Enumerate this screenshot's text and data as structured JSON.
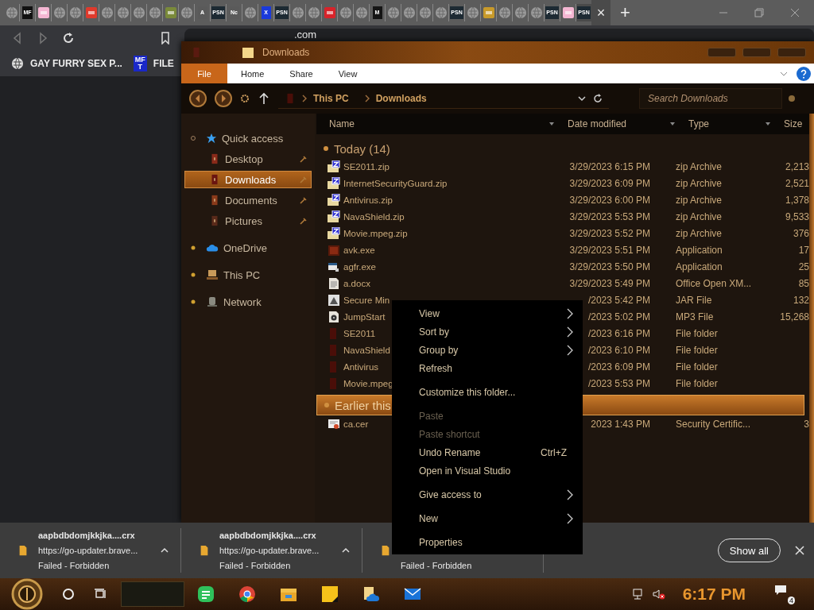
{
  "browser": {
    "tabs": [
      {
        "kind": "globe",
        "selected": false
      },
      {
        "kind": "text",
        "label": "MF",
        "color": "#111111",
        "selected": false
      },
      {
        "kind": "image",
        "color": "#f4b6d2",
        "selected": false
      },
      {
        "kind": "globe",
        "selected": false
      },
      {
        "kind": "globe",
        "selected": false
      },
      {
        "kind": "image",
        "color": "#e03a2c",
        "selected": false
      },
      {
        "kind": "globe",
        "selected": false
      },
      {
        "kind": "globe",
        "selected": false
      },
      {
        "kind": "globe",
        "selected": false
      },
      {
        "kind": "globe",
        "selected": false
      },
      {
        "kind": "image",
        "color": "#7a8a3a",
        "selected": false
      },
      {
        "kind": "globe",
        "selected": false
      },
      {
        "kind": "text",
        "label": "A",
        "color": "#5a5a5a",
        "selected": false
      },
      {
        "kind": "text",
        "label": "PSN",
        "color": "#1d2a33",
        "selected": false
      },
      {
        "kind": "text",
        "label": "Nc",
        "color": "#5a5a5a",
        "selected": false
      },
      {
        "kind": "globe",
        "selected": false
      },
      {
        "kind": "text",
        "label": "X",
        "color": "#1a3adb",
        "selected": false
      },
      {
        "kind": "text",
        "label": "PSN",
        "color": "#1d2a33",
        "selected": false
      },
      {
        "kind": "globe",
        "selected": false
      },
      {
        "kind": "globe",
        "selected": false
      },
      {
        "kind": "image",
        "color": "#d8232a",
        "selected": false
      },
      {
        "kind": "globe",
        "selected": false
      },
      {
        "kind": "globe",
        "selected": false
      },
      {
        "kind": "text",
        "label": "M",
        "color": "#151515",
        "selected": false
      },
      {
        "kind": "globe",
        "selected": false
      },
      {
        "kind": "globe",
        "selected": false
      },
      {
        "kind": "globe",
        "selected": false
      },
      {
        "kind": "globe",
        "selected": false
      },
      {
        "kind": "text",
        "label": "PSN",
        "color": "#1d2a33",
        "selected": false
      },
      {
        "kind": "globe",
        "selected": false
      },
      {
        "kind": "image",
        "color": "#c89a2a",
        "selected": false
      },
      {
        "kind": "globe",
        "selected": false
      },
      {
        "kind": "globe",
        "selected": false
      },
      {
        "kind": "globe",
        "selected": false
      },
      {
        "kind": "text",
        "label": "PSN",
        "color": "#1d2a33",
        "selected": false
      },
      {
        "kind": "image",
        "color": "#f4b6d2",
        "selected": false
      },
      {
        "kind": "text",
        "label": "PSN",
        "color": "#1d2a33",
        "selected": true
      }
    ],
    "close_tab": "×",
    "new_tab": "+",
    "address": ".com",
    "bookmarks": [
      {
        "kind": "globe",
        "label": "GAY FURRY SEX P..."
      },
      {
        "kind": "badge",
        "badge_lines": [
          "MF",
          "T"
        ],
        "label": "FILE"
      }
    ]
  },
  "explorer": {
    "title": "Downloads",
    "ribbon_tabs": [
      {
        "label": "File",
        "selected": true
      },
      {
        "label": "Home",
        "selected": false
      },
      {
        "label": "Share",
        "selected": false
      },
      {
        "label": "View",
        "selected": false
      }
    ],
    "breadcrumb": [
      "This PC",
      "Downloads"
    ],
    "search": {
      "placeholder": "Search Downloads"
    },
    "nav": [
      {
        "label": "Quick access",
        "kind": "star",
        "expanded": true,
        "selected": false,
        "children": [
          {
            "label": "Desktop",
            "kind": "desktop",
            "selected": false,
            "pinned": true
          },
          {
            "label": "Downloads",
            "kind": "downloads",
            "selected": true,
            "pinned": true
          },
          {
            "label": "Documents",
            "kind": "documents",
            "selected": false,
            "pinned": true
          },
          {
            "label": "Pictures",
            "kind": "pictures",
            "selected": false,
            "pinned": true
          }
        ]
      },
      {
        "label": "OneDrive",
        "kind": "cloud",
        "expanded": false,
        "selected": false
      },
      {
        "label": "This PC",
        "kind": "pc",
        "expanded": false,
        "selected": false
      },
      {
        "label": "Network",
        "kind": "network",
        "expanded": false,
        "selected": false
      }
    ],
    "columns": [
      "Name",
      "Date modified",
      "Type",
      "Size"
    ],
    "groups": [
      {
        "label": "Today (14)",
        "highlighted": false,
        "rows": [
          {
            "kind": "zip",
            "name": "SE2011.zip",
            "date": "3/29/2023 6:15 PM",
            "type": "zip Archive",
            "size": "2,213"
          },
          {
            "kind": "zip",
            "name": "InternetSecurityGuard.zip",
            "date": "3/29/2023 6:09 PM",
            "type": "zip Archive",
            "size": "2,521"
          },
          {
            "kind": "zip",
            "name": "Antivirus.zip",
            "date": "3/29/2023 6:00 PM",
            "type": "zip Archive",
            "size": "1,378"
          },
          {
            "kind": "zip",
            "name": "NavaShield.zip",
            "date": "3/29/2023 5:53 PM",
            "type": "zip Archive",
            "size": "9,533"
          },
          {
            "kind": "zip",
            "name": "Movie.mpeg.zip",
            "date": "3/29/2023 5:52 PM",
            "type": "zip Archive",
            "size": "376"
          },
          {
            "kind": "exe",
            "name": "avk.exe",
            "date": "3/29/2023 5:51 PM",
            "type": "Application",
            "size": "17"
          },
          {
            "kind": "app",
            "name": "agfr.exe",
            "date": "3/29/2023 5:50 PM",
            "type": "Application",
            "size": "25"
          },
          {
            "kind": "doc",
            "name": "a.docx",
            "date": "3/29/2023 5:49 PM",
            "type": "Office Open XM...",
            "size": "85"
          },
          {
            "kind": "jar",
            "name": "Secure Min",
            "date": "/2023 5:42 PM",
            "type": "JAR File",
            "size": "132"
          },
          {
            "kind": "mp3",
            "name": "JumpStart",
            "date": "/2023 5:02 PM",
            "type": "MP3 File",
            "size": "15,268"
          },
          {
            "kind": "folder",
            "name": "SE2011",
            "date": "/2023 6:16 PM",
            "type": "File folder"
          },
          {
            "kind": "folder",
            "name": "NavaShield",
            "date": "/2023 6:10 PM",
            "type": "File folder"
          },
          {
            "kind": "folder",
            "name": "Antivirus",
            "date": "/2023 6:09 PM",
            "type": "File folder"
          },
          {
            "kind": "folder",
            "name": "Movie.mpeg",
            "date": "/2023 5:53 PM",
            "type": "File folder"
          }
        ]
      },
      {
        "label": "Earlier this",
        "highlighted": true,
        "rows": [
          {
            "kind": "cert",
            "name": "ca.cer",
            "date": "2023 1:43 PM",
            "type": "Security Certific...",
            "size": "3"
          }
        ]
      }
    ]
  },
  "context_menu": {
    "sections": [
      {
        "items": [
          {
            "label": "View",
            "submenu": true,
            "disabled": false
          },
          {
            "label": "Sort by",
            "submenu": true,
            "disabled": false
          },
          {
            "label": "Group by",
            "submenu": true,
            "disabled": false
          },
          {
            "label": "Refresh",
            "submenu": false,
            "disabled": false
          }
        ]
      },
      {
        "items": [
          {
            "label": "Customize this folder...",
            "submenu": false,
            "disabled": false
          }
        ]
      },
      {
        "items": [
          {
            "label": "Paste",
            "submenu": false,
            "disabled": true
          },
          {
            "label": "Paste shortcut",
            "submenu": false,
            "disabled": true
          },
          {
            "label": "Undo Rename",
            "shortcut": "Ctrl+Z",
            "submenu": false,
            "disabled": false
          },
          {
            "label": "Open in Visual Studio",
            "submenu": false,
            "disabled": false
          }
        ]
      },
      {
        "items": [
          {
            "label": "Give access to",
            "submenu": true,
            "disabled": false
          }
        ]
      },
      {
        "items": [
          {
            "label": "New",
            "submenu": true,
            "disabled": false
          }
        ]
      },
      {
        "items": [
          {
            "label": "Properties",
            "submenu": false,
            "disabled": false
          }
        ]
      }
    ]
  },
  "downloads": {
    "items": [
      {
        "name": "aapbdbdomjkkjka....crx",
        "url": "https://go-updater.brave...",
        "status": "Failed - Forbidden"
      },
      {
        "name": "aapbdbdomjkkjka....crx",
        "url": "https://go-updater.brave...",
        "status": "Failed - Forbidden"
      },
      {
        "status": "Failed - Forbidden"
      }
    ],
    "show_all": "Show all"
  },
  "taskbar": {
    "apps": [
      {
        "kind": "notes"
      },
      {
        "kind": "chrome"
      },
      {
        "kind": "explorer"
      },
      {
        "kind": "sticky"
      },
      {
        "kind": "onedrive"
      },
      {
        "kind": "mail"
      }
    ],
    "volume_muted": true,
    "clock": "6:17 PM",
    "notifications": "4"
  }
}
